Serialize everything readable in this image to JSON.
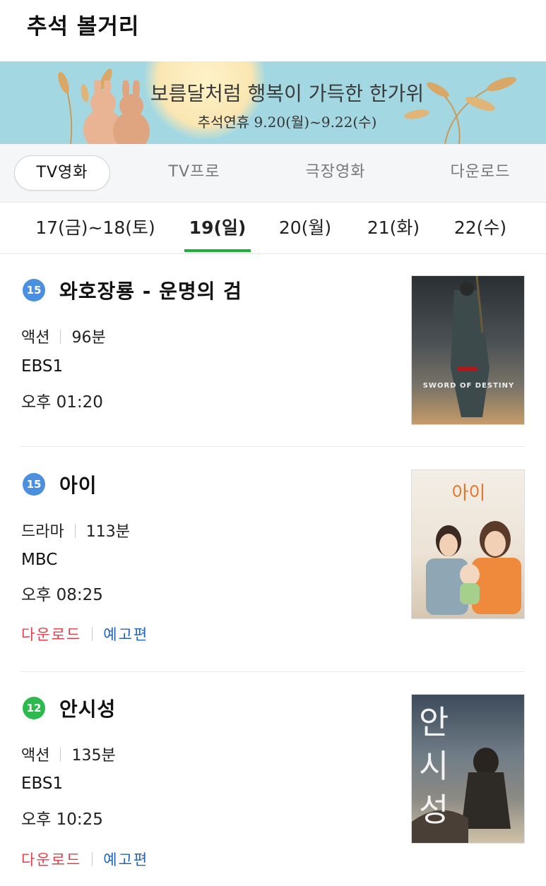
{
  "header": {
    "title": "추석 볼거리"
  },
  "banner": {
    "headline": "보름달처럼 행복이 가득한 한가위",
    "subtitle": "추석연휴 9.20(월)~9.22(수)"
  },
  "category_tabs": [
    {
      "label": "TV영화",
      "active": true
    },
    {
      "label": "TV프로",
      "active": false
    },
    {
      "label": "극장영화",
      "active": false
    },
    {
      "label": "다운로드",
      "active": false
    }
  ],
  "day_tabs": [
    {
      "label": "17(금)~18(토)",
      "active": false
    },
    {
      "label": "19(일)",
      "active": true
    },
    {
      "label": "20(월)",
      "active": false
    },
    {
      "label": "21(화)",
      "active": false
    },
    {
      "label": "22(수)",
      "active": false
    }
  ],
  "accent_color": "#1fb23a",
  "movies": [
    {
      "rating": "15",
      "rating_color": "#4a8fe0",
      "title": "와호장룡 - 운명의 검",
      "genre": "액션",
      "runtime": "96분",
      "channel": "EBS1",
      "time": "오후 01:20",
      "poster_text": "SWORD OF DESTINY"
    },
    {
      "rating": "15",
      "rating_color": "#4a8fe0",
      "title": "아이",
      "genre": "드라마",
      "runtime": "113분",
      "channel": "MBC",
      "time": "오후 08:25",
      "poster_text": "아이",
      "download_label": "다운로드",
      "trailer_label": "예고편"
    },
    {
      "rating": "12",
      "rating_color": "#2db94d",
      "title": "안시성",
      "genre": "액션",
      "runtime": "135분",
      "channel": "EBS1",
      "time": "오후 10:25",
      "poster_text": "안시성",
      "download_label": "다운로드",
      "trailer_label": "예고편"
    }
  ]
}
